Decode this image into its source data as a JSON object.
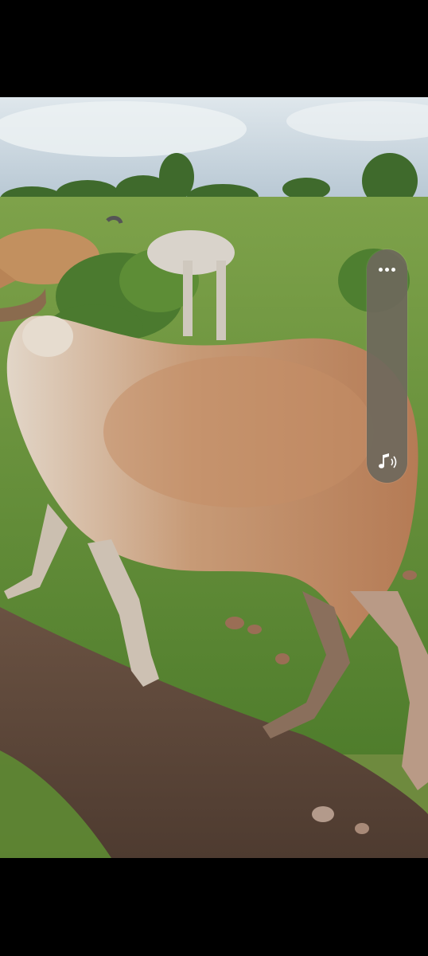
{
  "screen": {
    "letterbox_color": "#000000"
  },
  "video": {
    "scene_description_icon": "video-frame",
    "sky_color": "#c9d6df",
    "grass_color": "#6f9a3c",
    "soil_color": "#5a4536"
  },
  "side_panel": {
    "background": "#6e685c",
    "more_icon": "more-dots-icon",
    "audio_icon": "music-note-sound-icon"
  }
}
